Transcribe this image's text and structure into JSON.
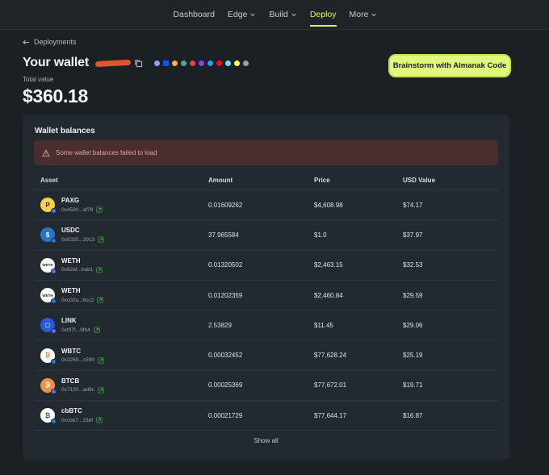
{
  "nav": {
    "items": [
      {
        "label": "Dashboard",
        "dropdown": false,
        "active": false
      },
      {
        "label": "Edge",
        "dropdown": true,
        "active": false
      },
      {
        "label": "Build",
        "dropdown": true,
        "active": false
      },
      {
        "label": "Deploy",
        "dropdown": false,
        "active": true
      },
      {
        "label": "More",
        "dropdown": true,
        "active": false
      }
    ],
    "accent": "#d8f56a"
  },
  "header": {
    "back_label": "Deployments",
    "title": "Your wallet",
    "total_label": "Total value",
    "total_value": "$360.18",
    "cta_label": "Brainstorm with Almanak Code",
    "chain_icons": [
      "ethereum-icon",
      "base-icon",
      "bnb-icon",
      "gnosis-icon",
      "avalanche-icon",
      "polygon-icon",
      "arbitrum-icon",
      "optimism-icon",
      "linea-icon",
      "celo-icon",
      "sonic-icon"
    ]
  },
  "balances": {
    "title": "Wallet balances",
    "alert": "Some wallet balances failed to load",
    "columns": [
      "Asset",
      "Amount",
      "Price",
      "USD Value"
    ],
    "rows": [
      {
        "name": "PAXG",
        "addr": "0x4580...af78",
        "amount": "0.01609262",
        "price": "$4,608.98",
        "usd": "$74.17",
        "icon": "paxg-icon",
        "color": "#f4d24a"
      },
      {
        "name": "USDC",
        "addr": "0x8335...2913",
        "amount": "37.965584",
        "price": "$1.0",
        "usd": "$37.97",
        "icon": "usdc-icon",
        "color": "#2775ca"
      },
      {
        "name": "WETH",
        "addr": "0x82af...bab1",
        "amount": "0.01320502",
        "price": "$2,463.15",
        "usd": "$32.53",
        "icon": "weth-icon",
        "color": "#ffffff"
      },
      {
        "name": "WETH",
        "addr": "0xc02a...6cc2",
        "amount": "0.01202359",
        "price": "$2,460.84",
        "usd": "$29.59",
        "icon": "weth-icon",
        "color": "#ffffff"
      },
      {
        "name": "LINK",
        "addr": "0xf97f...9fb4",
        "amount": "2.53829",
        "price": "$11.45",
        "usd": "$29.06",
        "icon": "link-icon",
        "color": "#2a5ada"
      },
      {
        "name": "WBTC",
        "addr": "0x2260...c599",
        "amount": "0.00032452",
        "price": "$77,628.24",
        "usd": "$25.19",
        "icon": "wbtc-icon",
        "color": "#ffffff"
      },
      {
        "name": "BTCB",
        "addr": "0x7130...ad9c",
        "amount": "0.00025369",
        "price": "$77,672.01",
        "usd": "$19.71",
        "icon": "btcb-icon",
        "color": "#f09242"
      },
      {
        "name": "cbBTC",
        "addr": "0xcbb7...33bf",
        "amount": "0.00021729",
        "price": "$77,644.17",
        "usd": "$16.87",
        "icon": "cbbtc-icon",
        "color": "#ffffff"
      }
    ],
    "show_all": "Show all"
  }
}
